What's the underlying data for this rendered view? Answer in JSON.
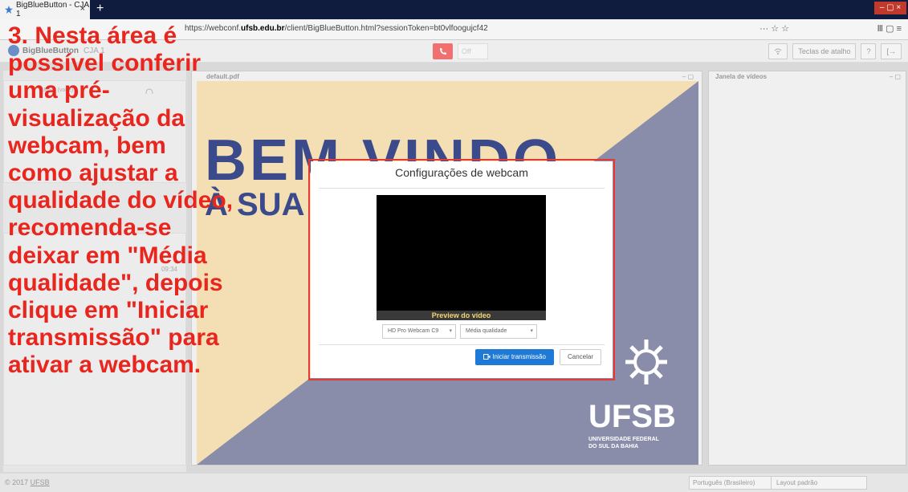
{
  "browser": {
    "tab_title": "BigBlueButton - CJA 1",
    "tab_close": "×",
    "new_tab": "+",
    "url_prefix": "https://webconf.",
    "url_host": "ufsb.edu.br",
    "url_path": "/client/BigBlueButton.html?sessionToken=bt0vlfoogujcf42",
    "url_icons": "··· ☆ ☆",
    "lib_icons": "Ⅲ ▢ ≡",
    "window_controls": "– ▢ ×"
  },
  "app": {
    "logo_text": "BigBlueButton",
    "room_name": "CJA 1",
    "mic_label": "Off",
    "shortcuts_label": "Teclas de atalho",
    "help_label": "?",
    "logout_label": "[→"
  },
  "users": {
    "current_user": "UFSB (você)"
  },
  "chat": {
    "time": "09:34"
  },
  "presentation": {
    "title": "default.pdf",
    "controls": "– ▢",
    "slide_heading": "BEM VINDO",
    "slide_sub": "À SUA",
    "slide_logo_text": "UFSB",
    "slide_uni_line1": "UNIVERSIDADE FEDERAL",
    "slide_uni_line2": "DO SUL DA BAHIA"
  },
  "videos": {
    "title": "Janela de vídeos",
    "controls": "– ▢"
  },
  "footer": {
    "copyright": "© 2017 ",
    "copyright_link": "UFSB",
    "language": "Português (Brasileiro)",
    "layout": "Layout padrão"
  },
  "modal": {
    "title": "Configurações de webcam",
    "preview_label": "Preview do vídeo",
    "camera_select": "HD Pro Webcam C9",
    "quality_select": "Média qualidade",
    "start_button": "Iniciar transmissão",
    "cancel_button": "Cancelar"
  },
  "instruction": "3. Nesta área é\npossível conferir\numa pré-\nvisualização da\nwebcam, bem\ncomo ajustar a\nqualidade do vídeo,\nrecomenda-se\ndeixar em \"Média\nqualidade\", depois\nclique em \"Iniciar\ntransmissão\" para\nativar a webcam.",
  "colors": {
    "accent_red": "#e8261e",
    "primary_blue": "#1f7ad6",
    "slide_navy": "#3a4a8a",
    "slide_gray": "#8a8daa",
    "slide_cream": "#f3dfb3"
  },
  "icons": [
    "star-favicon",
    "close-icon",
    "plus-icon",
    "phone-icon",
    "signal-icon",
    "help-icon",
    "logout-icon",
    "camera-icon",
    "headset-icon"
  ]
}
